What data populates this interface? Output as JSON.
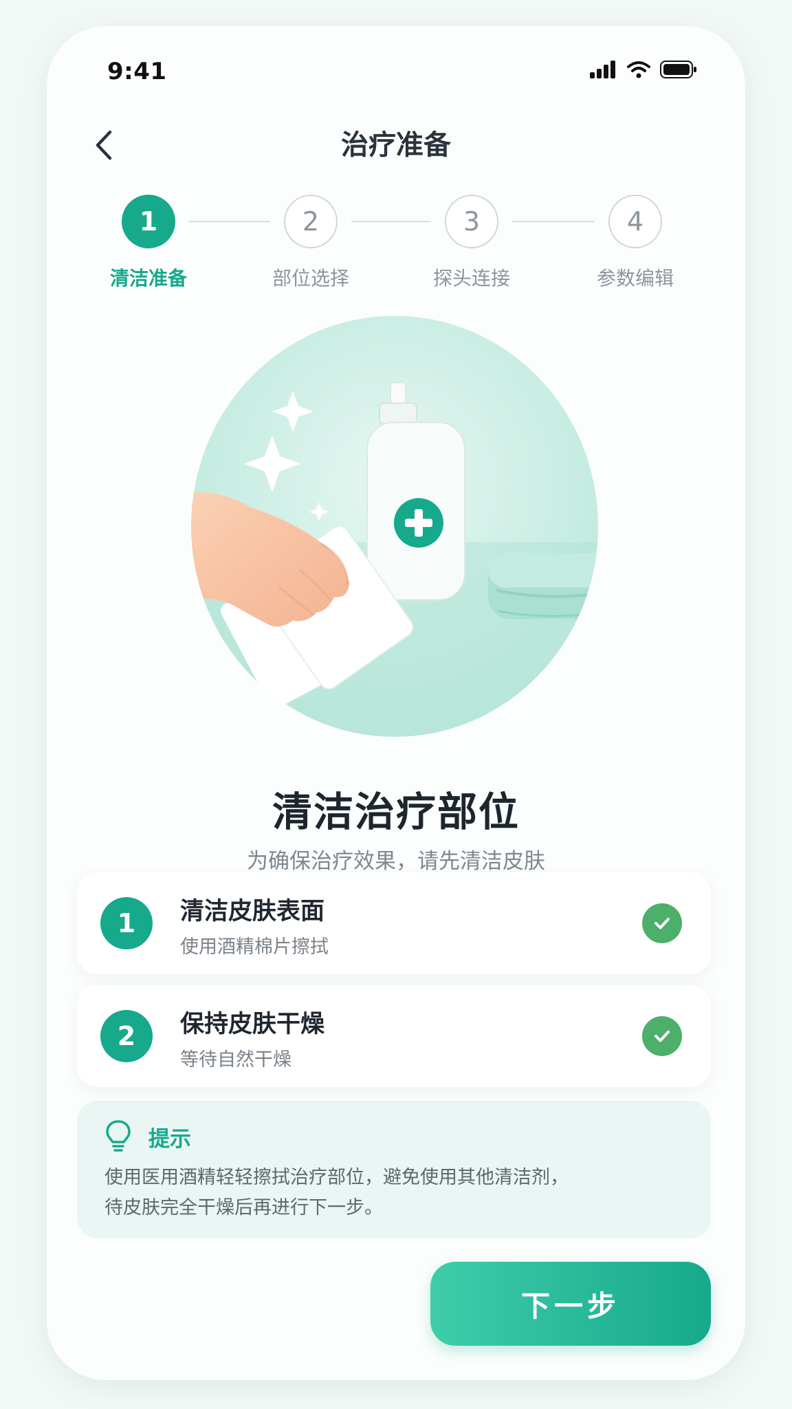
{
  "status_bar": {
    "time": "9:41"
  },
  "header": {
    "title": "治疗准备"
  },
  "steps": [
    {
      "number": "1",
      "label": "清洁准备",
      "state": "active"
    },
    {
      "number": "2",
      "label": "部位选择",
      "state": "pending"
    },
    {
      "number": "3",
      "label": "探头连接",
      "state": "pending"
    },
    {
      "number": "4",
      "label": "参数编辑",
      "state": "pending"
    }
  ],
  "main": {
    "heading": "清洁治疗部位",
    "subtitle": "为确保治疗效果，请先清洁皮肤"
  },
  "checklist": [
    {
      "number": "1",
      "title": "清洁皮肤表面",
      "subtitle": "使用酒精棉片擦拭",
      "done": true
    },
    {
      "number": "2",
      "title": "保持皮肤干燥",
      "subtitle": "等待自然干燥",
      "done": true
    }
  ],
  "tip": {
    "title": "提示",
    "line1": "使用医用酒精轻轻擦拭治疗部位，避免使用其他清洁剂，",
    "line2": "待皮肤完全干燥后再进行下一步。"
  },
  "footer": {
    "next_label": "下一步"
  },
  "colors": {
    "accent": "#16a98c",
    "check": "#4caf6a",
    "tip_bg": "#eaf6f3"
  }
}
